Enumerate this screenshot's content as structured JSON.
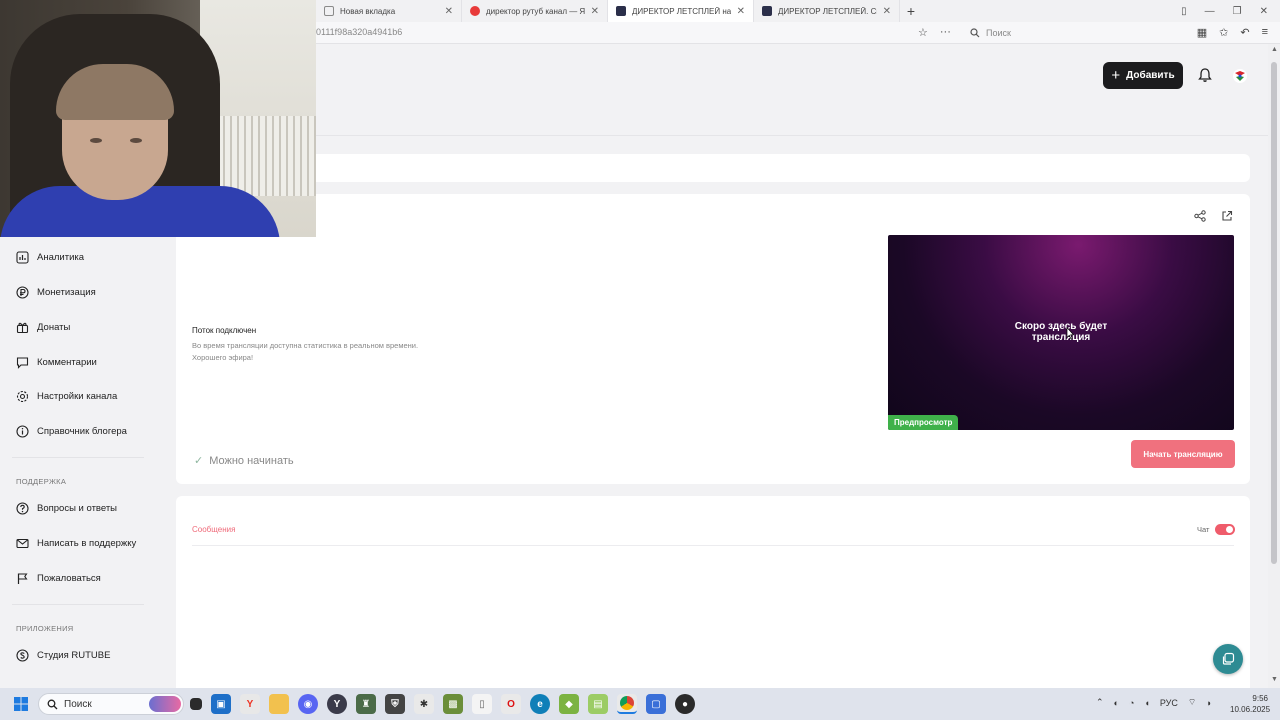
{
  "browser": {
    "tabs": [
      {
        "title": "Новая вкладка",
        "color": "#8a8a8a"
      },
      {
        "title": "директор рутуб канал — Ян...",
        "color": "#e83a3a"
      },
      {
        "title": "ДИРЕКТОР ЛЕТСПЛЕЙ на R...",
        "color": "#2b2f4a"
      },
      {
        "title": "ДИРЕКТОР ЛЕТСПЛЕЙ. Смо...",
        "color": "#2b2f4a"
      }
    ],
    "url": "0111f98a320a4941b6",
    "search_placeholder": "Поиск"
  },
  "header": {
    "add_label": "Добавить"
  },
  "sidebar": {
    "items": [
      {
        "label": "Аналитика",
        "icon": "analytics-icon"
      },
      {
        "label": "Монетизация",
        "icon": "ruble-icon"
      },
      {
        "label": "Донаты",
        "icon": "gift-icon"
      },
      {
        "label": "Комментарии",
        "icon": "comment-icon"
      },
      {
        "label": "Настройки канала",
        "icon": "gear-icon"
      },
      {
        "label": "Справочник блогера",
        "icon": "info-icon"
      }
    ],
    "support_heading": "ПОДДЕРЖКА",
    "support_items": [
      {
        "label": "Вопросы и ответы",
        "icon": "question-icon"
      },
      {
        "label": "Написать в поддержку",
        "icon": "mail-icon"
      },
      {
        "label": "Пожаловаться",
        "icon": "flag-icon"
      }
    ],
    "apps_heading": "ПРИЛОЖЕНИЯ",
    "apps_items": [
      {
        "label": "Студия RUTUBE",
        "icon": "studio-icon"
      }
    ]
  },
  "stream": {
    "status_title": "Поток подключен",
    "status_desc_1": "Во время трансляции доступна статистика в реальном времени.",
    "status_desc_2": "Хорошего эфира!",
    "preview_line1": "Скоро здесь будет",
    "preview_line2": "трансляция",
    "preview_badge": "Предпросмотр",
    "ready_label": "Можно начинать",
    "start_button": "Начать трансляцию"
  },
  "chat": {
    "tab_label": "Сообщения",
    "toggle_label": "Чат",
    "toggle_on": true
  },
  "taskbar": {
    "search_placeholder": "Поиск",
    "lang": "РУС",
    "time": "9:56",
    "date": "10.06.2025"
  },
  "colors": {
    "accent_red": "#f0717e",
    "badge_green": "#3fb14a",
    "dark_button": "#1c1c1e"
  }
}
